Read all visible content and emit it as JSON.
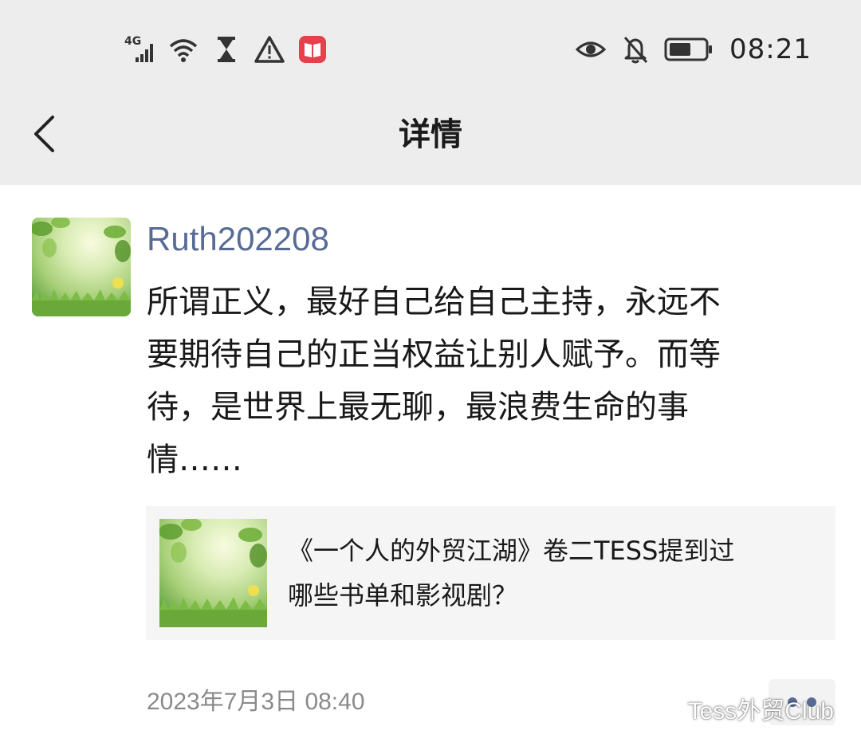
{
  "status_bar": {
    "network_label": "4G",
    "time": "08:21",
    "icons": [
      "signal-icon",
      "wifi-icon",
      "hourglass-icon",
      "warning-icon",
      "book-app-icon",
      "eye-icon",
      "bell-off-icon",
      "battery-icon"
    ],
    "colors": {
      "book_app": "#e8404a"
    }
  },
  "nav": {
    "title": "详情",
    "back_icon": "chevron-left-icon"
  },
  "post": {
    "username": "Ruth202208",
    "content_lines": [
      "所谓正义，最好自己给自己主持，永远不",
      "要期待自己的正当权益让别人赋予。而等",
      "待，是世界上最无聊，最浪费生命的事",
      "情……"
    ],
    "link": {
      "title_lines": [
        "《一个人的外贸江湖》卷二TESS提到过",
        "哪些书单和影视剧？"
      ]
    },
    "timestamp": "2023年7月3日 08:40"
  },
  "watermark": {
    "text": "Tess外贸Club",
    "icon": "wechat-icon"
  },
  "colors": {
    "username": "#576b95",
    "header_bg": "#ededed",
    "card_bg": "#f5f5f5",
    "timestamp": "#8a8a8a"
  }
}
